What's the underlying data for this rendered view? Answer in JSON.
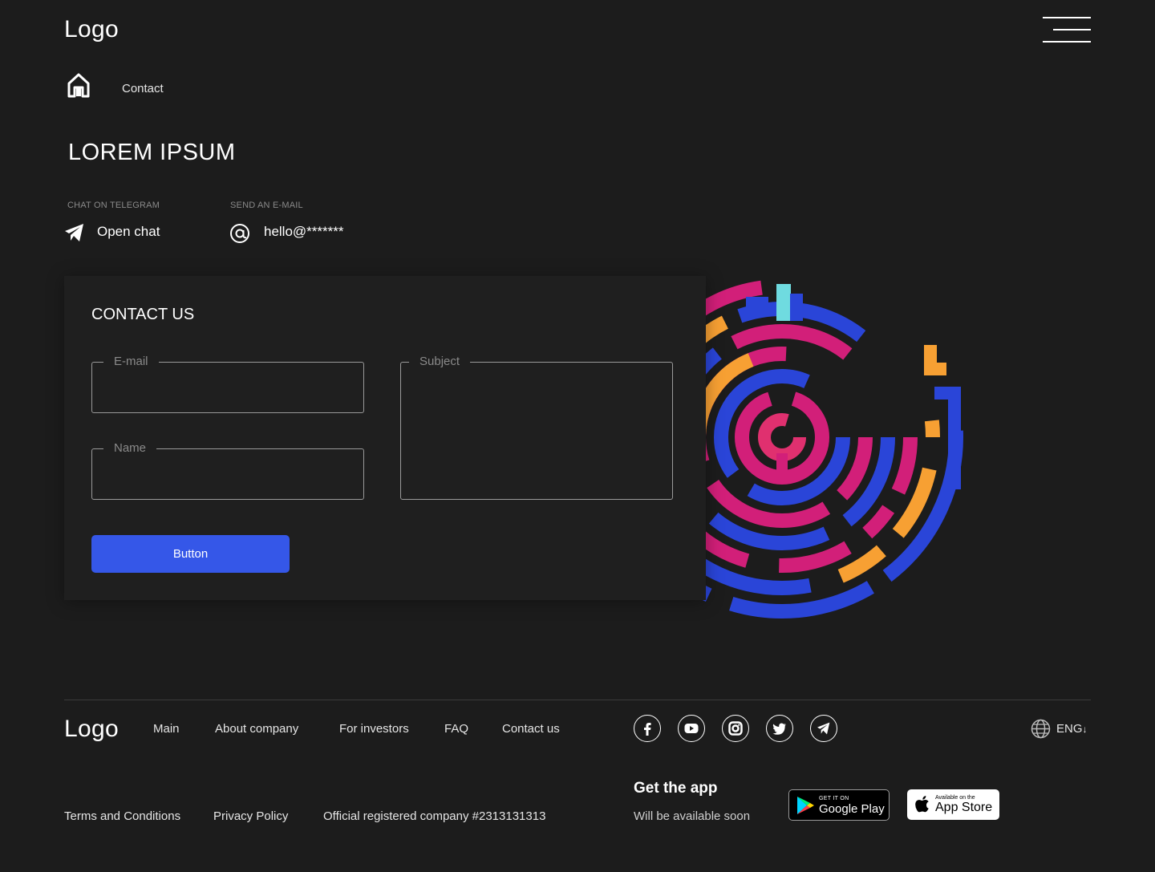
{
  "header": {
    "logo": "Logo",
    "menu_icon": "hamburger-menu-icon"
  },
  "breadcrumb": {
    "home_icon": "home-icon",
    "current": "Contact"
  },
  "page": {
    "title": "LOREM IPSUM"
  },
  "contacts": {
    "telegram": {
      "label": "CHAT ON TELEGRAM",
      "link": "Open chat",
      "icon": "telegram-icon"
    },
    "email": {
      "label": "SEND AN E-MAIL",
      "link": "hello@*******",
      "icon": "at-icon"
    }
  },
  "form": {
    "title": "CONTACT US",
    "email_label": "E-mail",
    "name_label": "Name",
    "subject_label": "Subject",
    "button": "Button"
  },
  "footer": {
    "logo": "Logo",
    "nav": [
      "Main",
      "About company",
      "For investors",
      "FAQ",
      "Contact us"
    ],
    "socials": [
      "facebook-icon",
      "youtube-icon",
      "instagram-icon",
      "twitter-icon",
      "telegram-icon"
    ],
    "language": "ENG",
    "legal": [
      "Terms and Conditions",
      "Privacy Policy",
      "Official registered company #2313131313"
    ],
    "app": {
      "title": "Get the app",
      "subtitle": "Will be available soon",
      "google_small": "GET IT ON",
      "google_big": "Google Play",
      "apple_small": "Available on the",
      "apple_big": "App Store"
    }
  },
  "colors": {
    "background": "#1c1c1c",
    "accent": "#3557e8",
    "maze_blue": "#2a45d8",
    "maze_pink": "#d21f79",
    "maze_orange": "#f7a033",
    "maze_cyan": "#6fdbe0"
  }
}
